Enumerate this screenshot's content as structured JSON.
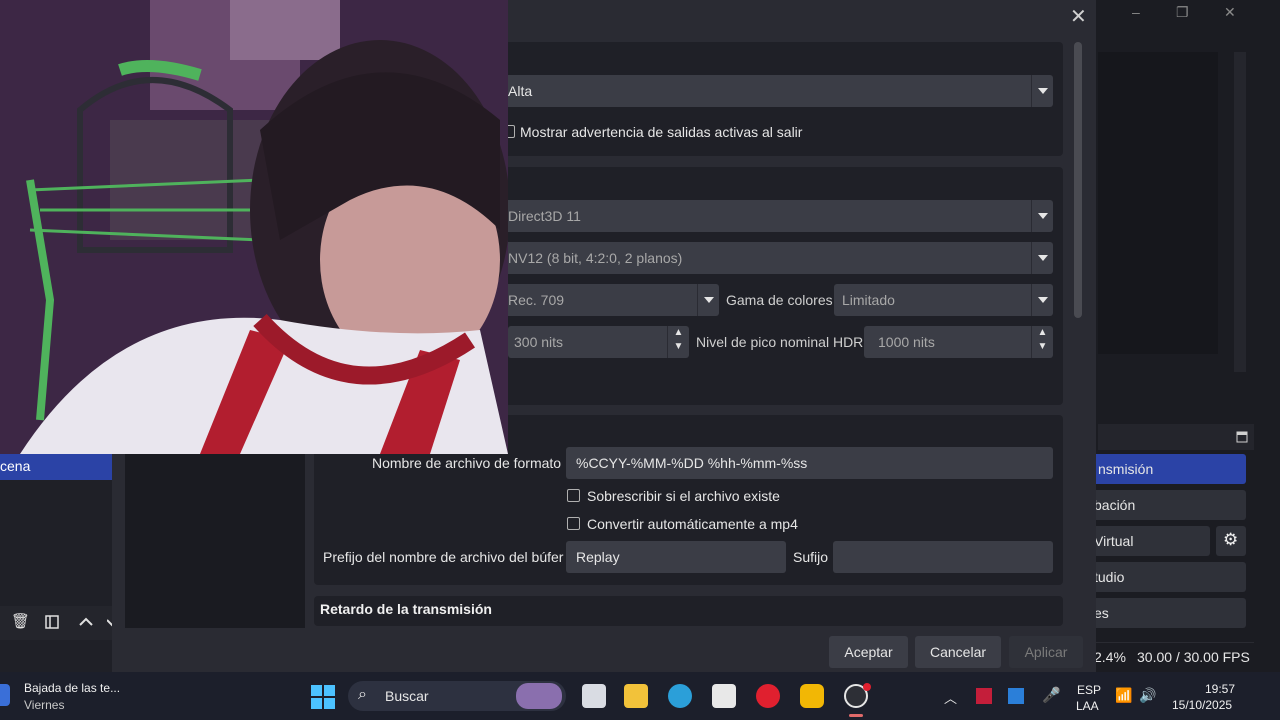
{
  "dialog": {
    "general": {
      "priority_value": "Alta",
      "warn_active_outputs_label": "Mostrar advertencia de salidas activas al salir"
    },
    "video": {
      "renderer_value": "Direct3D 11",
      "color_format_value": "NV12 (8 bit, 4:2:0, 2 planos)",
      "color_space_value": "Rec. 709",
      "color_range_label": "Gama de colores",
      "color_range_value": "Limitado",
      "sdr_white_value": "300 nits",
      "hdr_peak_label": "Nivel de pico nominal HDR",
      "hdr_peak_value": "1000 nits"
    },
    "recording": {
      "filename_format_label": "Nombre de archivo de formato",
      "filename_format_value": "%CCYY-%MM-%DD %hh-%mm-%ss",
      "overwrite_label": "Sobrescribir si el archivo existe",
      "auto_remux_label": "Convertir automáticamente a mp4",
      "buffer_prefix_label": "Prefijo del nombre de archivo del búfer",
      "buffer_prefix_value": "Replay",
      "suffix_label": "Sufijo",
      "suffix_value": ""
    },
    "stream_delay_title": "Retardo de la transmisión",
    "buttons": {
      "ok": "Aceptar",
      "cancel": "Cancelar",
      "apply": "Aplicar"
    }
  },
  "controls": {
    "stream": "nsmisión",
    "record": "bación",
    "virtual_cam": "Virtual",
    "studio": "tudio",
    "exit": "es"
  },
  "scenes": {
    "active_scene": "cena"
  },
  "status": {
    "cpu": "2.4%",
    "fps": "30.00 / 30.00 FPS"
  },
  "taskbar": {
    "news_title": "Bajada de las te...",
    "news_sub": "Viernes",
    "search_placeholder": "Buscar",
    "lang_line1": "ESP",
    "lang_line2": "LAA",
    "time": "19:57",
    "date": "15/10/2025"
  },
  "colors": {
    "accent_blue": "#2b43a6",
    "dialog_bg": "#2a2b33",
    "group_bg": "#1f2027"
  }
}
